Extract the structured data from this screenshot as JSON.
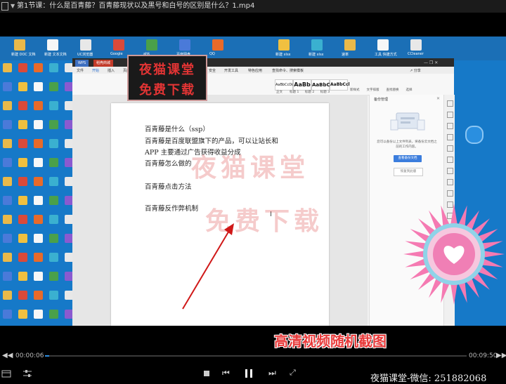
{
  "player": {
    "title": "第1节课：什么是百青藤？百青藤现状以及黑号和白号的区别是什么？1.mp4",
    "time_current": "00:00:06",
    "time_total": "00:09:50",
    "progress": 0.0102,
    "accent_color": "#2f8ee0"
  },
  "desktop": {
    "top_icons": [
      "新建 DOC 文档",
      "新建 文本文档",
      "UC浏览器",
      "Google",
      "ahk",
      "百度网盘",
      "QQ",
      "",
      "新建 xlsx",
      "新建 xlsx",
      "速率",
      "工具 快捷方式",
      "CCleaner"
    ],
    "left_icons": [
      [
        "新建",
        "新建 DOC"
      ],
      [
        "",
        ""
      ],
      [
        "",
        ""
      ],
      [
        "",
        ""
      ],
      [
        "",
        ""
      ],
      [
        "",
        ""
      ],
      [
        "",
        ""
      ],
      [
        "",
        ""
      ],
      [
        "",
        ""
      ],
      [
        "",
        ""
      ],
      [
        "",
        ""
      ],
      [
        "",
        ""
      ],
      [
        "",
        ""
      ],
      [
        "",
        ""
      ]
    ]
  },
  "wps": {
    "tabs": [
      "WPS",
      "稻壳商城"
    ],
    "menu": [
      "文件",
      "开始",
      "插入",
      "页面布局",
      "引用",
      "审阅",
      "视图",
      "章节",
      "安全",
      "开发工具",
      "特色应用",
      "查找命令、搜索模板"
    ],
    "ribbon_styles": [
      "正文",
      "标题 1",
      "标题 2",
      "标题 3"
    ],
    "style_samples": [
      "AaBbCcDd",
      "AaBb",
      "AaBbC",
      "AaBbCcl"
    ],
    "ribbon_right": [
      "新样式",
      "文字排版",
      "查找替换",
      "选择"
    ],
    "share_label": "分享",
    "doc_lines": [
      "百青藤是什么（ssp）",
      "百青藤是百度联盟旗下的产品，可以让站长和",
      "APP 主要通过广告获得收益分成",
      "百青藤怎么做的",
      "",
      "百青藤点击方法",
      "",
      "百青藤反作弊机制"
    ],
    "side_panel": {
      "title": "备份管理",
      "desc": "您可以备份以上文件列表，将备份云文档之前的工作内容。",
      "primary_button": "查看备份文档",
      "secondary_button": "恢复到此版"
    }
  },
  "watermark": {
    "logo_line1": "夜猫课堂",
    "logo_line2": "免费下载",
    "overlay_line1": "夜猫课堂",
    "overlay_line2": "免费下载"
  },
  "caption": "高清视频随机截图",
  "footer_text": "夜猫课堂-微信: 251882068"
}
